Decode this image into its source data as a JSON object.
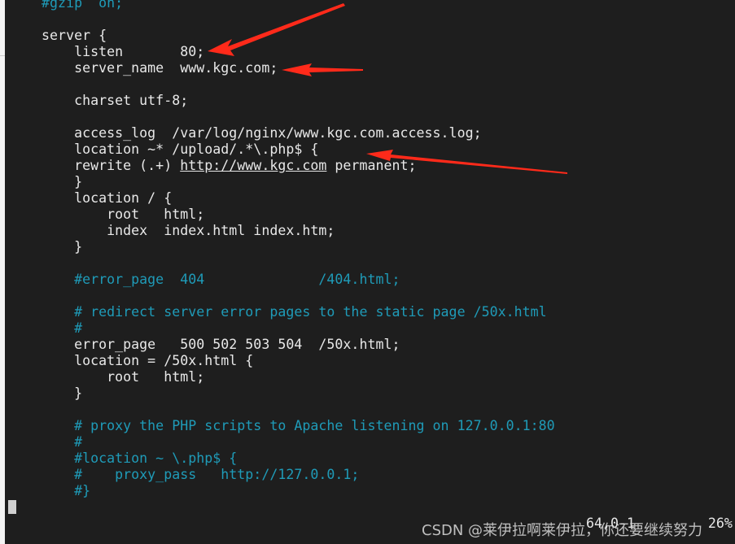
{
  "editor": {
    "lines": [
      {
        "text": "    #gzip  on;",
        "type": "comment"
      },
      {
        "text": "",
        "type": "code"
      },
      {
        "text": "    server {",
        "type": "code"
      },
      {
        "text": "        listen       80;",
        "type": "code"
      },
      {
        "text": "        server_name  www.kgc.com;",
        "type": "code"
      },
      {
        "text": "",
        "type": "code"
      },
      {
        "text": "        charset utf-8;",
        "type": "code"
      },
      {
        "text": "",
        "type": "code"
      },
      {
        "text": "        access_log  /var/log/nginx/www.kgc.com.access.log;",
        "type": "code"
      },
      {
        "text": "        location ~* /upload/.*\\.php$ {",
        "type": "code"
      },
      {
        "text": "        rewrite (.+) ",
        "type": "code",
        "link": "http://www.kgc.com",
        "after": " permanent;"
      },
      {
        "text": "        }",
        "type": "code"
      },
      {
        "text": "        location / {",
        "type": "code"
      },
      {
        "text": "            root   html;",
        "type": "code"
      },
      {
        "text": "            index  index.html index.htm;",
        "type": "code"
      },
      {
        "text": "        }",
        "type": "code"
      },
      {
        "text": "",
        "type": "code"
      },
      {
        "text": "        #error_page  404              /404.html;",
        "type": "comment"
      },
      {
        "text": "",
        "type": "code"
      },
      {
        "text": "        # redirect server error pages to the static page /50x.html",
        "type": "comment"
      },
      {
        "text": "        #",
        "type": "comment"
      },
      {
        "text": "        error_page   500 502 503 504  /50x.html;",
        "type": "code"
      },
      {
        "text": "        location = /50x.html {",
        "type": "code"
      },
      {
        "text": "            root   html;",
        "type": "code"
      },
      {
        "text": "        }",
        "type": "code"
      },
      {
        "text": "",
        "type": "code"
      },
      {
        "text": "        # proxy the PHP scripts to Apache listening on 127.0.0.1:80",
        "type": "comment"
      },
      {
        "text": "        #",
        "type": "comment"
      },
      {
        "text": "        #location ~ \\.php$ {",
        "type": "comment"
      },
      {
        "text": "        #    proxy_pass   http://127.0.0.1;",
        "type": "comment"
      },
      {
        "text": "        #}",
        "type": "comment"
      }
    ],
    "status_position": "64,0-1",
    "status_percent": "26%"
  },
  "watermark": "CSDN @莱伊拉啊莱伊拉，你还要继续努力",
  "colors": {
    "background": "#1e1e1e",
    "comment": "#1f9bb8",
    "arrow": "#ff2a1a"
  }
}
